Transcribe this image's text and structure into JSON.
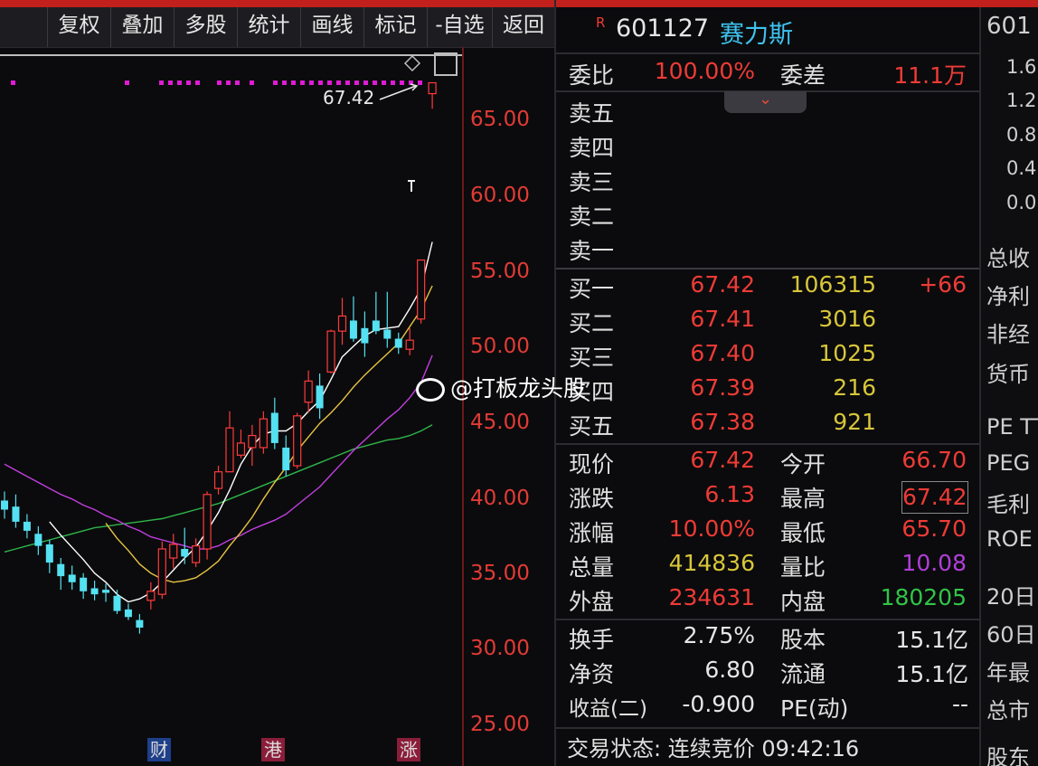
{
  "toolbar": {
    "items": [
      "复权",
      "叠加",
      "多股",
      "统计",
      "画线",
      "标记",
      "-自选",
      "返回"
    ]
  },
  "chart": {
    "price_labels": [
      "65.00",
      "60.00",
      "55.00",
      "50.00",
      "45.00",
      "40.00",
      "35.00",
      "30.00",
      "25.00"
    ],
    "last_price_tag": "67.42",
    "markers": [
      "财",
      "港",
      "涨"
    ],
    "colors": {
      "up": "#ff3b3b",
      "down": "#54e1f2",
      "ma5": "#ffffff",
      "ma10": "#e8c443",
      "ma20": "#c23ee0",
      "ma60": "#2fb54a"
    }
  },
  "chart_data": {
    "type": "candlestick",
    "ylim": [
      25,
      70
    ],
    "candles": [
      {
        "o": 39.8,
        "c": 39.2,
        "h": 40.4,
        "l": 38.6
      },
      {
        "o": 39.4,
        "c": 38.4,
        "h": 40.2,
        "l": 38.0
      },
      {
        "o": 38.4,
        "c": 37.8,
        "h": 38.9,
        "l": 37.3
      },
      {
        "o": 37.6,
        "c": 36.8,
        "h": 38.1,
        "l": 36.2
      },
      {
        "o": 36.9,
        "c": 35.7,
        "h": 37.2,
        "l": 35.0
      },
      {
        "o": 35.6,
        "c": 34.8,
        "h": 36.0,
        "l": 33.9
      },
      {
        "o": 34.9,
        "c": 34.4,
        "h": 35.5,
        "l": 33.9
      },
      {
        "o": 34.7,
        "c": 33.8,
        "h": 35.0,
        "l": 33.3
      },
      {
        "o": 34.0,
        "c": 33.6,
        "h": 34.5,
        "l": 33.2
      },
      {
        "o": 33.9,
        "c": 33.7,
        "h": 34.3,
        "l": 33.1
      },
      {
        "o": 33.5,
        "c": 32.5,
        "h": 33.9,
        "l": 32.3
      },
      {
        "o": 32.6,
        "c": 32.1,
        "h": 33.0,
        "l": 31.9
      },
      {
        "o": 31.9,
        "c": 31.4,
        "h": 32.3,
        "l": 31.0
      },
      {
        "o": 33.2,
        "c": 33.8,
        "h": 34.4,
        "l": 32.6
      },
      {
        "o": 33.6,
        "c": 36.6,
        "h": 37.1,
        "l": 33.3
      },
      {
        "o": 36.0,
        "c": 36.9,
        "h": 37.6,
        "l": 35.3
      },
      {
        "o": 36.6,
        "c": 36.1,
        "h": 38.0,
        "l": 35.6
      },
      {
        "o": 35.7,
        "c": 36.8,
        "h": 37.3,
        "l": 35.4
      },
      {
        "o": 36.6,
        "c": 40.2,
        "h": 40.4,
        "l": 35.9
      },
      {
        "o": 40.6,
        "c": 41.7,
        "h": 42.1,
        "l": 40.2
      },
      {
        "o": 41.7,
        "c": 44.6,
        "h": 45.7,
        "l": 41.7
      },
      {
        "o": 42.8,
        "c": 43.6,
        "h": 44.5,
        "l": 42.6
      },
      {
        "o": 43.3,
        "c": 44.1,
        "h": 44.8,
        "l": 42.1
      },
      {
        "o": 43.3,
        "c": 45.2,
        "h": 45.7,
        "l": 42.9
      },
      {
        "o": 45.6,
        "c": 43.6,
        "h": 46.6,
        "l": 43.2
      },
      {
        "o": 43.3,
        "c": 41.8,
        "h": 44.1,
        "l": 41.4
      },
      {
        "o": 42.1,
        "c": 45.4,
        "h": 45.6,
        "l": 41.9
      },
      {
        "o": 46.3,
        "c": 47.7,
        "h": 48.4,
        "l": 45.6
      },
      {
        "o": 47.4,
        "c": 45.9,
        "h": 48.2,
        "l": 45.2
      },
      {
        "o": 48.3,
        "c": 51.0,
        "h": 51.1,
        "l": 48.2
      },
      {
        "o": 51.0,
        "c": 52.0,
        "h": 53.2,
        "l": 50.1
      },
      {
        "o": 51.7,
        "c": 50.5,
        "h": 53.3,
        "l": 50.3
      },
      {
        "o": 51.2,
        "c": 50.2,
        "h": 52.3,
        "l": 49.3
      },
      {
        "o": 51.7,
        "c": 51.0,
        "h": 53.6,
        "l": 50.8
      },
      {
        "o": 51.1,
        "c": 50.5,
        "h": 53.6,
        "l": 49.9
      },
      {
        "o": 50.5,
        "c": 49.9,
        "h": 50.9,
        "l": 49.5
      },
      {
        "o": 49.8,
        "c": 50.4,
        "h": 51.2,
        "l": 49.4
      },
      {
        "o": 51.8,
        "c": 55.7,
        "h": 55.7,
        "l": 51.5
      },
      {
        "o": 66.7,
        "c": 67.42,
        "h": 67.42,
        "l": 65.7
      }
    ],
    "ma5": [
      null,
      null,
      null,
      null,
      38.4,
      37.5,
      36.7,
      35.9,
      35.0,
      34.4,
      33.6,
      33.1,
      33.3,
      33.7,
      34.4,
      35.2,
      36.0,
      36.7,
      37.8,
      39.0,
      40.5,
      42.2,
      43.4,
      44.2,
      44.4,
      44.4,
      44.9,
      45.7,
      46.4,
      47.8,
      49.3,
      50.0,
      50.7,
      51.1,
      51.2,
      51.3,
      52.5,
      53.8,
      56.9
    ],
    "ma10": [
      null,
      null,
      null,
      null,
      null,
      null,
      null,
      null,
      null,
      38.3,
      37.3,
      36.5,
      35.6,
      35.0,
      34.6,
      34.4,
      34.5,
      34.7,
      35.2,
      35.8,
      36.8,
      37.7,
      38.7,
      39.9,
      41.0,
      42.0,
      43.1,
      44.0,
      44.9,
      45.6,
      46.4,
      47.3,
      48.1,
      48.8,
      49.5,
      50.2,
      51.3,
      52.4,
      54.0
    ],
    "ma20": [
      42.2,
      41.8,
      41.4,
      41.0,
      40.6,
      40.2,
      39.9,
      39.5,
      39.2,
      38.8,
      38.5,
      38.1,
      37.8,
      37.4,
      37.2,
      37.0,
      36.8,
      36.6,
      36.6,
      36.8,
      37.2,
      37.5,
      37.9,
      38.2,
      38.5,
      38.9,
      39.5,
      40.1,
      40.7,
      41.5,
      42.3,
      43.1,
      43.8,
      44.5,
      45.2,
      45.8,
      46.6,
      47.6,
      49.4
    ],
    "ma60": [
      36.4,
      36.6,
      36.8,
      37.0,
      37.2,
      37.4,
      37.6,
      37.8,
      38.0,
      38.1,
      38.2,
      38.3,
      38.4,
      38.5,
      38.6,
      38.8,
      39.0,
      39.2,
      39.4,
      39.6,
      39.9,
      40.2,
      40.5,
      40.8,
      41.1,
      41.4,
      41.7,
      42.0,
      42.3,
      42.6,
      42.9,
      43.2,
      43.4,
      43.6,
      43.8,
      43.9,
      44.1,
      44.4,
      44.8
    ]
  },
  "quote": {
    "r_badge": "R",
    "code": "601127",
    "name": "赛力斯",
    "weibi_label": "委比",
    "weibi_value": "100.00%",
    "weicha_label": "委差",
    "weicha_value": "11.1万",
    "sells": [
      "卖五",
      "卖四",
      "卖三",
      "卖二",
      "卖一"
    ],
    "buys": [
      {
        "label": "买一",
        "price": "67.42",
        "vol": "106315",
        "chg": "+66"
      },
      {
        "label": "买二",
        "price": "67.41",
        "vol": "3016",
        "chg": ""
      },
      {
        "label": "买三",
        "price": "67.40",
        "vol": "1025",
        "chg": ""
      },
      {
        "label": "买四",
        "price": "67.39",
        "vol": "216",
        "chg": ""
      },
      {
        "label": "买五",
        "price": "67.38",
        "vol": "921",
        "chg": ""
      }
    ],
    "stats": [
      {
        "l1": "现价",
        "v1": "67.42",
        "c1": "red",
        "l2": "今开",
        "v2": "66.70",
        "c2": "red"
      },
      {
        "l1": "涨跌",
        "v1": "6.13",
        "c1": "red",
        "l2": "最高",
        "v2": "67.42",
        "c2": "red"
      },
      {
        "l1": "涨幅",
        "v1": "10.00%",
        "c1": "red",
        "l2": "最低",
        "v2": "65.70",
        "c2": "red"
      },
      {
        "l1": "总量",
        "v1": "414836",
        "c1": "yel",
        "l2": "量比",
        "v2": "10.08",
        "c2": "pur"
      },
      {
        "l1": "外盘",
        "v1": "234631",
        "c1": "red",
        "l2": "内盘",
        "v2": "180205",
        "c2": "grn"
      }
    ],
    "fund": [
      {
        "l1": "换手",
        "v1": "2.75%",
        "l2": "股本",
        "v2": "15.1亿"
      },
      {
        "l1": "净资",
        "v1": "6.80",
        "l2": "流通",
        "v2": "15.1亿"
      },
      {
        "l1": "收益(二)",
        "v1": "-0.900",
        "l2": "PE(动)",
        "v2": "--"
      }
    ],
    "trade_status": "交易状态: 连续竞价 09:42:16"
  },
  "watermark": "@打板龙头股",
  "right_strip": {
    "title": "601",
    "scale": [
      "1.6",
      "1.2",
      "0.8",
      "0.4",
      "0.0"
    ],
    "rows": [
      "总收",
      "净利",
      "非经",
      "货币",
      "PE TT",
      "PEG",
      "毛利",
      "ROE",
      "20日",
      "60日",
      "年最",
      "总市",
      "股东"
    ]
  }
}
